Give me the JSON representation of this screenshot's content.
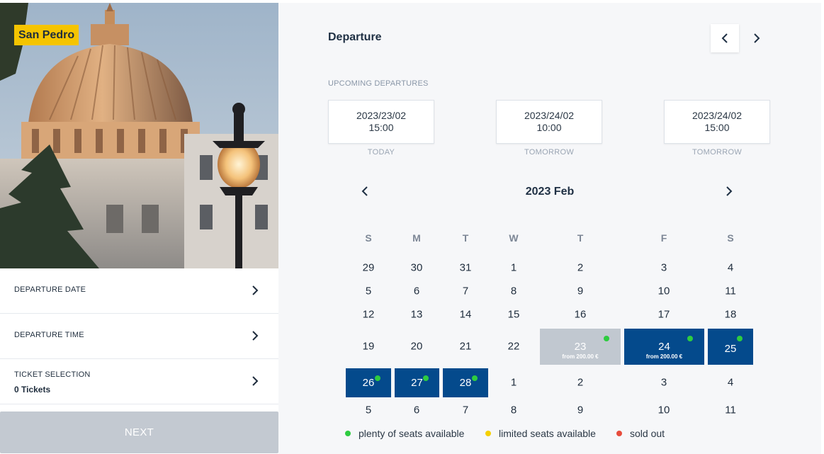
{
  "hero": {
    "badge": "San Pedro"
  },
  "steps": [
    {
      "label": "DEPARTURE DATE",
      "value": ""
    },
    {
      "label": "DEPARTURE TIME",
      "value": ""
    },
    {
      "label": "TICKET SELECTION",
      "value": "0 Tickets"
    }
  ],
  "next_button": "NEXT",
  "departure": {
    "title": "Departure",
    "upcoming_title": "UPCOMING DEPARTURES",
    "upcoming": [
      {
        "date": "2023/23/02",
        "time": "15:00",
        "when": "TODAY"
      },
      {
        "date": "2023/24/02",
        "time": "10:00",
        "when": "TOMORROW"
      },
      {
        "date": "2023/24/02",
        "time": "15:00",
        "when": "TOMORROW"
      }
    ]
  },
  "calendar": {
    "title": "2023 Feb",
    "weekdays": [
      "S",
      "M",
      "T",
      "W",
      "T",
      "F",
      "S"
    ],
    "weeks": [
      [
        "29",
        "30",
        "31",
        "1",
        "2",
        "3",
        "4"
      ],
      [
        "5",
        "6",
        "7",
        "8",
        "9",
        "10",
        "11"
      ],
      [
        "12",
        "13",
        "14",
        "15",
        "16",
        "17",
        "18"
      ],
      [
        "19",
        "20",
        "21",
        "22",
        "23",
        "24",
        "25"
      ],
      [
        "26",
        "27",
        "28",
        "1",
        "2",
        "3",
        "4"
      ],
      [
        "5",
        "6",
        "7",
        "8",
        "9",
        "10",
        "11"
      ]
    ],
    "available_days": [
      {
        "day": "23",
        "from": "from 200.00 €",
        "style": "grey"
      },
      {
        "day": "24",
        "from": "from 200.00 €",
        "style": "navy"
      },
      {
        "day": "25",
        "from": "",
        "style": "navy"
      },
      {
        "day": "26",
        "from": "",
        "style": "navy"
      },
      {
        "day": "27",
        "from": "",
        "style": "navy"
      },
      {
        "day": "28",
        "from": "",
        "style": "navy"
      }
    ]
  },
  "legend": [
    {
      "label": "plenty of seats available",
      "color": "#2ecc40"
    },
    {
      "label": "limited seats available",
      "color": "#f5d000"
    },
    {
      "label": "sold out",
      "color": "#e74c3c"
    }
  ],
  "colors": {
    "accent": "#044a8c",
    "badge": "#f5c400",
    "disabled": "#c3c9d1"
  }
}
